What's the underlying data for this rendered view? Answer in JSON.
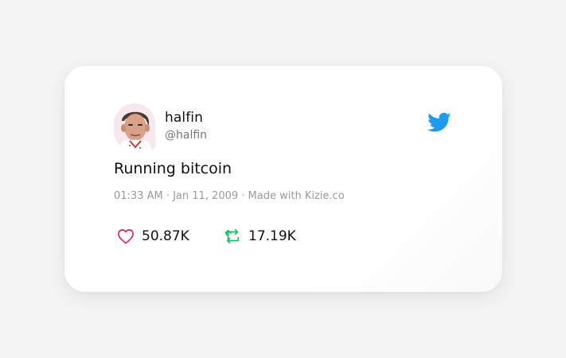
{
  "user": {
    "display_name": "halfin",
    "handle": "@halfin"
  },
  "tweet": {
    "text": "Running bitcoin",
    "meta": "01:33 AM · Jan 11, 2009 · Made with Kizie.co"
  },
  "stats": {
    "likes": "50.87K",
    "retweets": "17.19K"
  },
  "icons": {
    "brand": "twitter-bird-icon",
    "like": "heart-outline-icon",
    "retweet": "retweet-icon"
  },
  "colors": {
    "twitter_blue": "#1d9bf0",
    "like_red": "#e0245e",
    "retweet_green": "#17bf63"
  }
}
